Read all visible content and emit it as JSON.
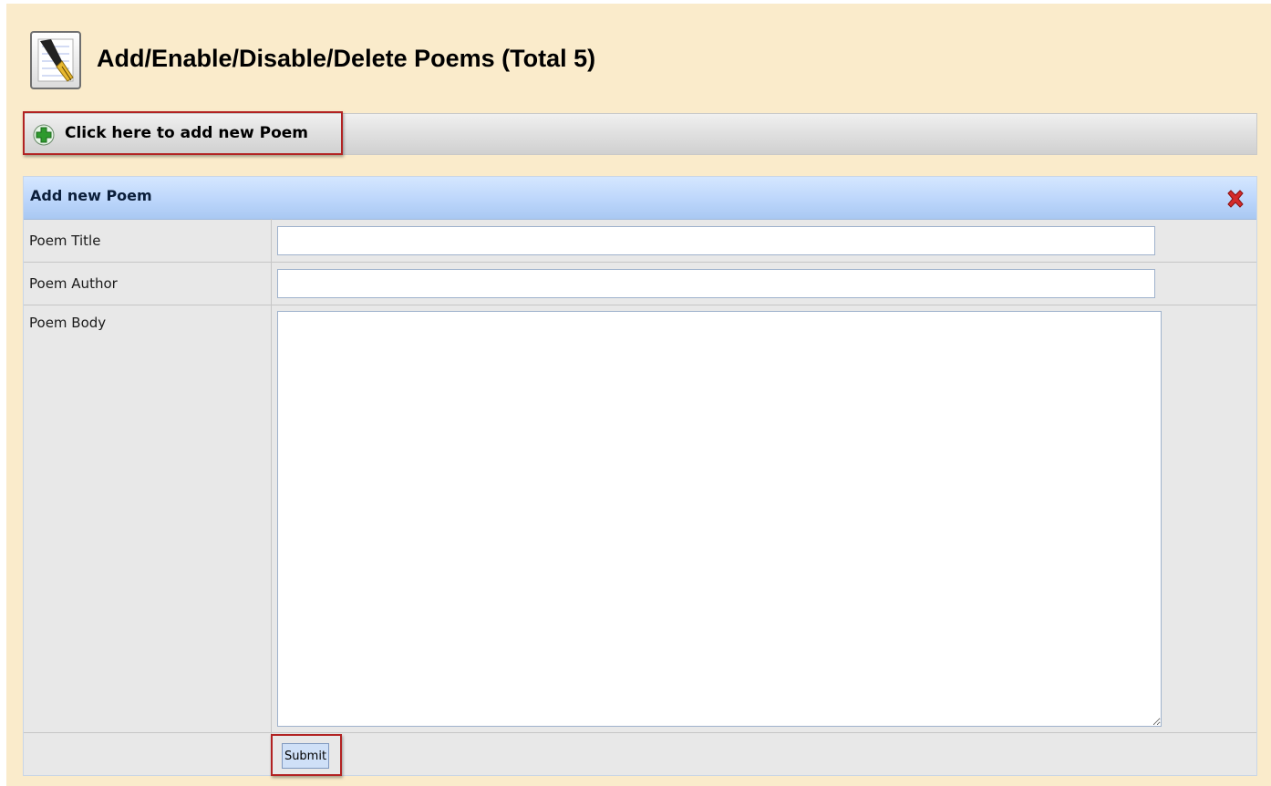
{
  "header": {
    "title": "Add/Enable/Disable/Delete Poems (Total 5)",
    "icon": "pen-nib-icon"
  },
  "add_bar": {
    "label": "Click here to add new Poem",
    "icon": "plus-icon"
  },
  "panel": {
    "title": "Add new Poem",
    "close_icon": "close-icon",
    "fields": {
      "title_label": "Poem Title",
      "title_value": "",
      "author_label": "Poem Author",
      "author_value": "",
      "body_label": "Poem Body",
      "body_value": ""
    },
    "submit_label": "Submit"
  },
  "colors": {
    "page_bg": "#faebcb",
    "panel_header": "#bcd6fb",
    "highlight_border": "#b22222",
    "plus_green": "#2e9a2e",
    "close_red": "#d42a2a"
  }
}
